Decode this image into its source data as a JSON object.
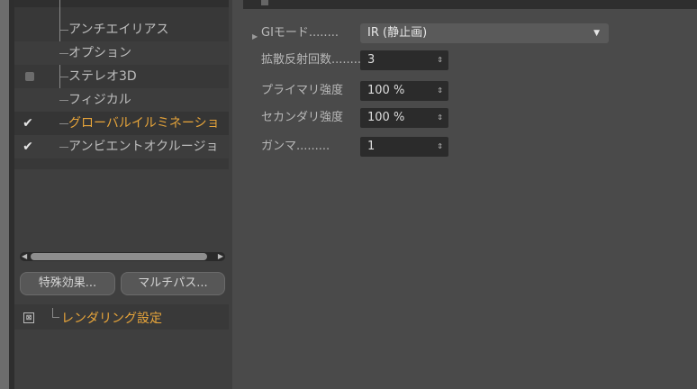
{
  "tree": {
    "items": [
      {
        "label": "アンチエイリアス",
        "check": "",
        "active": false
      },
      {
        "label": "オプション",
        "check": "",
        "active": false
      },
      {
        "label": "ステレオ3D",
        "check": "box",
        "active": false
      },
      {
        "label": "フィジカル",
        "check": "",
        "active": false
      },
      {
        "label": "グローバルイルミネーショ",
        "check": "✔",
        "active": true
      },
      {
        "label": "アンビエントオクルージョ",
        "check": "✔",
        "active": false
      }
    ]
  },
  "buttons": {
    "effects": "特殊効果...",
    "multipass": "マルチパス..."
  },
  "render_settings": {
    "label": "レンダリング設定"
  },
  "gi": {
    "mode_label": "GIモード........",
    "mode_value": "IR (静止画)",
    "diffuse_label": "拡散反射回数........",
    "diffuse_value": "3",
    "primary_label": "プライマリ強度",
    "primary_value": "100 %",
    "secondary_label": "セカンダリ強度",
    "secondary_value": "100 %",
    "gamma_label": "ガンマ.........",
    "gamma_value": "1"
  },
  "colors": {
    "accent": "#e8a53a",
    "panel": "#4a4a4a"
  }
}
